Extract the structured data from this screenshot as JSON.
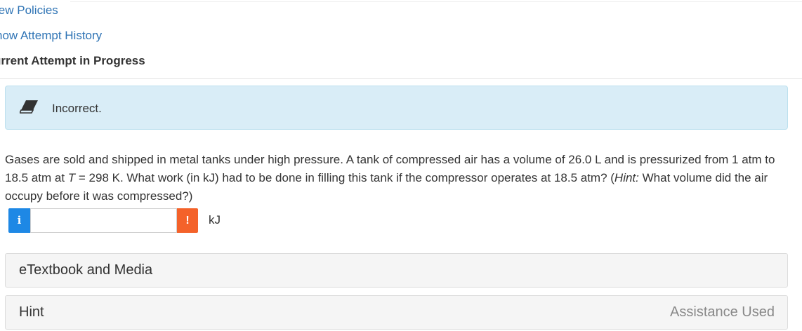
{
  "links": {
    "view_policies": "iew Policies",
    "show_history": "how Attempt History"
  },
  "attempt_heading": "urrent Attempt in Progress",
  "feedback": {
    "icon": "eraser-icon",
    "text": "Incorrect.",
    "background_color": "#d9edf7"
  },
  "question": {
    "part1": "Gases are sold and shipped in metal tanks under high pressure. A tank of compressed air has a volume of 26.0 L and is pressurized from 1 atm to 18.5 atm at ",
    "t_var": "T",
    "part2": " = 298 K. What work (in kJ) had to be done in filling this tank if the compressor operates at 18.5 atm? (",
    "hint_word": "Hint:",
    "part3": " What volume did the air occupy before it was compressed?)"
  },
  "answer": {
    "info_badge": "i",
    "value": "",
    "placeholder": "",
    "warning_badge": "!",
    "unit": "kJ",
    "info_color": "#1e88e5",
    "warning_color": "#f4622a"
  },
  "panels": {
    "etextbook_label": "eTextbook and Media",
    "hint_label": "Hint",
    "hint_status": "Assistance Used"
  }
}
